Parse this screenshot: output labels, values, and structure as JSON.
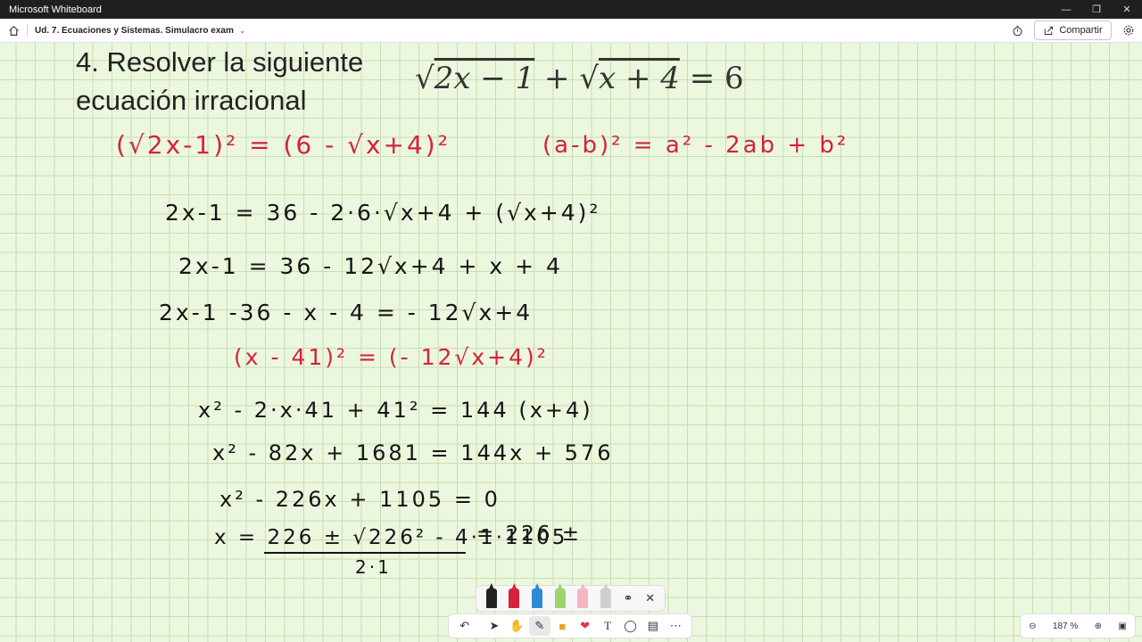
{
  "window": {
    "title": "Microsoft Whiteboard"
  },
  "header": {
    "board_title": "Ud. 7. Ecuaciones y Sistemas. Simulacro exam",
    "share_label": "Compartir"
  },
  "canvas": {
    "title_line1": "4. Resolver la siguiente",
    "title_line2": "ecuación irracional",
    "typed_equation": "√(2x − 1) + √(x + 4) = 6",
    "typed_rad1": "2x − 1",
    "typed_rad2": "x + 4",
    "typed_tail": "= 6",
    "ink": {
      "line1": "(√2x-1)² = (6 - √x+4)²",
      "identity": "(a-b)² = a² - 2ab + b²",
      "line2": "2x-1 = 36 - 2·6·√x+4 + (√x+4)²",
      "line3": "2x-1 = 36 - 12√x+4 + x + 4",
      "line4": "2x-1 -36 - x - 4 = - 12√x+4",
      "line5": "(x - 41)² = (- 12√x+4)²",
      "line6": "x² - 2·x·41 + 41² = 144 (x+4)",
      "line7": "x² - 82x + 1681 = 144x + 576",
      "line8": "x² - 226x + 1105 = 0",
      "line9_left": "x = 226 ± √226² - 4·1·1105",
      "line9_den": "2·1",
      "line9_right": "= 226 ±"
    }
  },
  "zoom": {
    "level": "187 %"
  },
  "colors": {
    "ink_black": "#151515",
    "ink_red": "#d4233a",
    "grid": "#c7deb2",
    "paper": "#ecf7df"
  }
}
